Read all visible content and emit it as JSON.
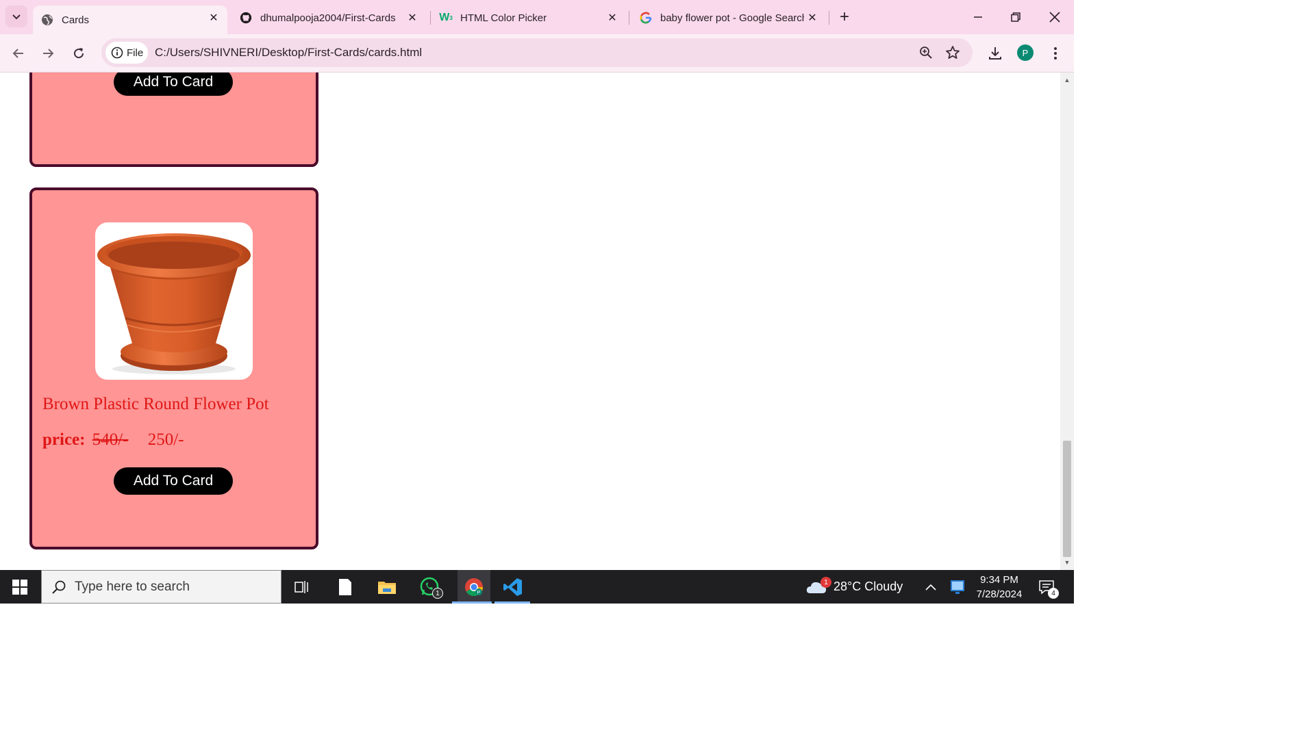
{
  "browser": {
    "tabs": [
      {
        "title": "Cards",
        "favicon": "globe-icon",
        "active": true
      },
      {
        "title": "dhumalpooja2004/First-Cards",
        "favicon": "github-icon",
        "active": false
      },
      {
        "title": "HTML Color Picker",
        "favicon": "w3schools-icon",
        "active": false
      },
      {
        "title": "baby flower pot - Google Search",
        "favicon": "google-icon",
        "active": false
      }
    ],
    "site_chip_label": "File",
    "url": "C:/Users/SHIVNERI/Desktop/First-Cards/cards.html",
    "profile_initial": "P"
  },
  "page": {
    "cards": [
      {
        "button_label": "Add To Card"
      },
      {
        "product_name": "Brown Plastic Round Flower Pot",
        "price_label": "price:",
        "old_price": "540/-",
        "new_price": "250/-",
        "button_label": "Add To Card"
      }
    ]
  },
  "taskbar": {
    "search_placeholder": "Type here to search",
    "weather": "28°C  Cloudy",
    "weather_badge": "1",
    "whatsapp_badge": "1",
    "time": "9:34 PM",
    "date": "7/28/2024",
    "notifications_badge": "4"
  },
  "colors": {
    "card_background": "#ff9595",
    "card_border": "#4a0b2a",
    "product_text": "#e01515",
    "chrome_tabbar": "#f9d9eb"
  }
}
